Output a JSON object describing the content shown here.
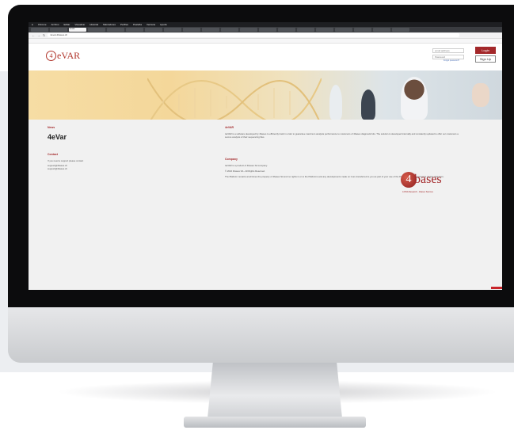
{
  "browser": {
    "menu": [
      "Chrome",
      "Archivo",
      "Editar",
      "Visualizar",
      "Historial",
      "Marcadores",
      "Perfiles",
      "Pestaña",
      "Ventana",
      "Ayuda"
    ],
    "status_right": "",
    "url": "4evar.4bases.ch",
    "tabs": [
      "",
      "",
      "4eVar",
      "",
      "",
      "",
      "",
      "",
      "",
      "",
      "",
      "",
      "",
      "",
      "",
      "",
      "",
      "",
      "",
      ""
    ],
    "bookmarks": [
      "",
      "",
      "",
      "",
      "",
      "",
      "",
      "",
      "",
      "",
      "",
      "",
      "",
      "",
      ""
    ]
  },
  "header": {
    "logo_text": "eVAR",
    "logo_digit": "4",
    "email_placeholder": "email address",
    "password_placeholder": "Password",
    "forgot_label": "Forgot password?",
    "login_label": "Login",
    "signup_label": "Sign Up"
  },
  "footer": {
    "news_title": "News",
    "brand_name": "4eVar",
    "contact_title": "Contact",
    "contact_text": "If you need a support please contact",
    "contact_email_1": "support@4bases.ch",
    "contact_email_2": "support@4bases.ch",
    "about_title": "4eVAR",
    "about_text": "4eVAR is a software developed by 4bases to efficiently track in order to guarantee maximum analysis performance to customers of 4bases diagnostic kits. The solution is developed internally and constantly updated to offer our customers a secure analysis of their sequencing files.",
    "company_title": "Company",
    "company_text_1": "4eVAR is a product of 4bases SA company.",
    "company_text_2": "© 2022 4bases SA - All Rights Reserved.",
    "company_text_3": "The Platform remains at all times the property of 4bases SA and no rights in or to the Platforms and any developments made on it are transferred to you as part of your use of the Platform. For all legal terms please click here.",
    "bases_digit": "4",
    "bases_text": "bases",
    "bases_tag": "A DNA Research - 4bases Sources"
  },
  "colors": {
    "brand_red": "#a3282a",
    "hero_gold": "#f4d79a"
  }
}
